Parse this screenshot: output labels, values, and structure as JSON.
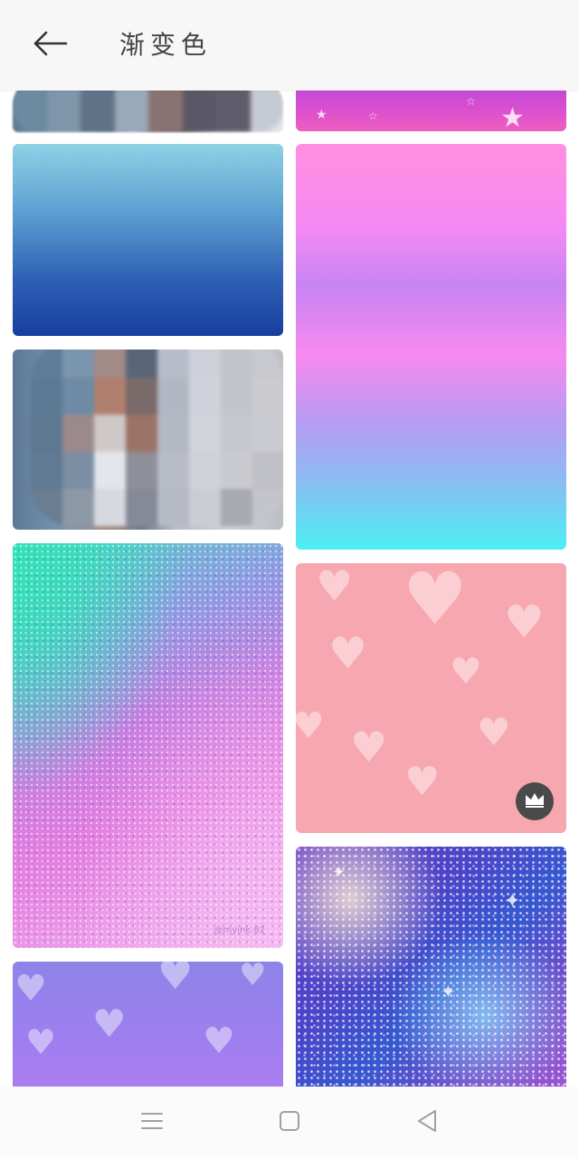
{
  "header": {
    "title": "渐变色",
    "back_icon": "arrow-left-icon"
  },
  "wallpapers": [
    {
      "id": "blurred-top",
      "style": "blurred",
      "column": "left"
    },
    {
      "id": "blue-gradient",
      "style": "gradient",
      "column": "left"
    },
    {
      "id": "blurred-mid",
      "style": "blurred",
      "column": "left"
    },
    {
      "id": "glitter",
      "style": "glitter",
      "column": "left",
      "watermark": "@myink.82"
    },
    {
      "id": "purple-hearts",
      "style": "hearts",
      "column": "left"
    },
    {
      "id": "stars-strip",
      "style": "stars",
      "column": "right"
    },
    {
      "id": "pastel-gradient",
      "style": "gradient",
      "column": "right"
    },
    {
      "id": "pink-hearts",
      "style": "hearts",
      "column": "right",
      "badge": "crown-icon"
    },
    {
      "id": "galaxy",
      "style": "galaxy",
      "column": "right"
    }
  ],
  "navbar": {
    "menu_icon": "menu-icon",
    "home_icon": "home-square-icon",
    "back_icon": "back-triangle-icon"
  },
  "colors": {
    "header_bg": "#f7f7f7",
    "badge_bg": "#4a4a4a",
    "nav_icon": "#9a9a9a"
  }
}
